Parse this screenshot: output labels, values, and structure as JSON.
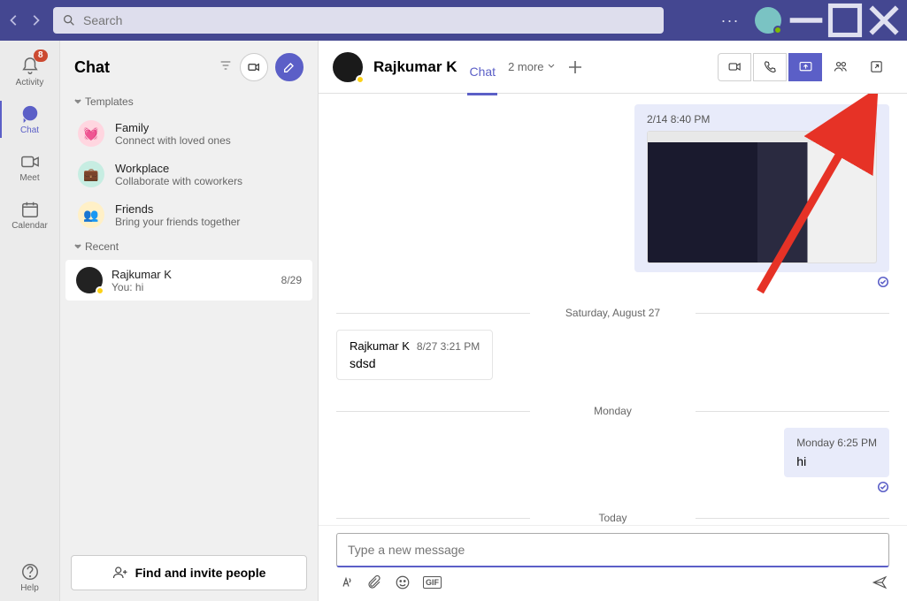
{
  "titlebar": {
    "search_placeholder": "Search"
  },
  "rail": {
    "activity": "Activity",
    "activity_badge": "8",
    "chat": "Chat",
    "meet": "Meet",
    "calendar": "Calendar",
    "help": "Help"
  },
  "sidebar": {
    "title": "Chat",
    "sec_templates": "Templates",
    "templates": [
      {
        "title": "Family",
        "sub": "Connect with loved ones"
      },
      {
        "title": "Workplace",
        "sub": "Collaborate with coworkers"
      },
      {
        "title": "Friends",
        "sub": "Bring your friends together"
      }
    ],
    "sec_recent": "Recent",
    "recent": [
      {
        "title": "Rajkumar K",
        "sub": "You: hi",
        "date": "8/29"
      }
    ],
    "find_label": "Find and invite people"
  },
  "conv": {
    "title": "Rajkumar K",
    "tab_chat": "Chat",
    "tab_more": "2 more",
    "messages": {
      "out0_ts": "2/14 8:40 PM",
      "divider0": "Saturday, August 27",
      "in0_name": "Rajkumar K",
      "in0_time": "8/27 3:21 PM",
      "in0_body": "sdsd",
      "divider1": "Monday",
      "out1_ts": "Monday 6:25 PM",
      "out1_body": "hi",
      "divider2": "Today"
    },
    "compose_placeholder": "Type a new message"
  },
  "colors": {
    "accent": "#5b5fc7",
    "arrow": "#e63226"
  }
}
